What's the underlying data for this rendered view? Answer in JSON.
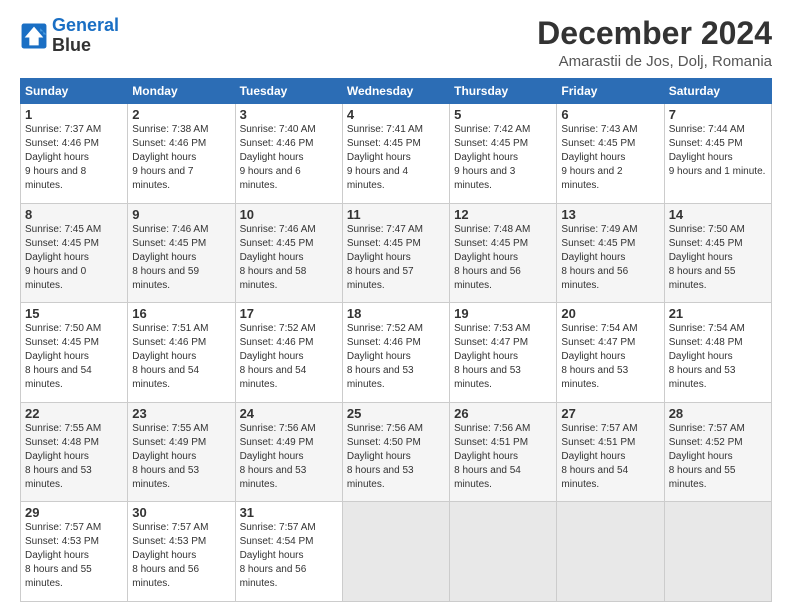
{
  "header": {
    "logo_line1": "General",
    "logo_line2": "Blue",
    "title": "December 2024",
    "subtitle": "Amarastii de Jos, Dolj, Romania"
  },
  "calendar": {
    "days_of_week": [
      "Sunday",
      "Monday",
      "Tuesday",
      "Wednesday",
      "Thursday",
      "Friday",
      "Saturday"
    ],
    "weeks": [
      [
        null,
        {
          "day": "2",
          "sunrise": "7:38 AM",
          "sunset": "4:46 PM",
          "daylight": "9 hours and 7 minutes."
        },
        {
          "day": "3",
          "sunrise": "7:40 AM",
          "sunset": "4:46 PM",
          "daylight": "9 hours and 6 minutes."
        },
        {
          "day": "4",
          "sunrise": "7:41 AM",
          "sunset": "4:45 PM",
          "daylight": "9 hours and 4 minutes."
        },
        {
          "day": "5",
          "sunrise": "7:42 AM",
          "sunset": "4:45 PM",
          "daylight": "9 hours and 3 minutes."
        },
        {
          "day": "6",
          "sunrise": "7:43 AM",
          "sunset": "4:45 PM",
          "daylight": "9 hours and 2 minutes."
        },
        {
          "day": "7",
          "sunrise": "7:44 AM",
          "sunset": "4:45 PM",
          "daylight": "9 hours and 1 minute."
        }
      ],
      [
        {
          "day": "8",
          "sunrise": "7:45 AM",
          "sunset": "4:45 PM",
          "daylight": "9 hours and 0 minutes."
        },
        {
          "day": "9",
          "sunrise": "7:46 AM",
          "sunset": "4:45 PM",
          "daylight": "8 hours and 59 minutes."
        },
        {
          "day": "10",
          "sunrise": "7:46 AM",
          "sunset": "4:45 PM",
          "daylight": "8 hours and 58 minutes."
        },
        {
          "day": "11",
          "sunrise": "7:47 AM",
          "sunset": "4:45 PM",
          "daylight": "8 hours and 57 minutes."
        },
        {
          "day": "12",
          "sunrise": "7:48 AM",
          "sunset": "4:45 PM",
          "daylight": "8 hours and 56 minutes."
        },
        {
          "day": "13",
          "sunrise": "7:49 AM",
          "sunset": "4:45 PM",
          "daylight": "8 hours and 56 minutes."
        },
        {
          "day": "14",
          "sunrise": "7:50 AM",
          "sunset": "4:45 PM",
          "daylight": "8 hours and 55 minutes."
        }
      ],
      [
        {
          "day": "15",
          "sunrise": "7:50 AM",
          "sunset": "4:45 PM",
          "daylight": "8 hours and 54 minutes."
        },
        {
          "day": "16",
          "sunrise": "7:51 AM",
          "sunset": "4:46 PM",
          "daylight": "8 hours and 54 minutes."
        },
        {
          "day": "17",
          "sunrise": "7:52 AM",
          "sunset": "4:46 PM",
          "daylight": "8 hours and 54 minutes."
        },
        {
          "day": "18",
          "sunrise": "7:52 AM",
          "sunset": "4:46 PM",
          "daylight": "8 hours and 53 minutes."
        },
        {
          "day": "19",
          "sunrise": "7:53 AM",
          "sunset": "4:47 PM",
          "daylight": "8 hours and 53 minutes."
        },
        {
          "day": "20",
          "sunrise": "7:54 AM",
          "sunset": "4:47 PM",
          "daylight": "8 hours and 53 minutes."
        },
        {
          "day": "21",
          "sunrise": "7:54 AM",
          "sunset": "4:48 PM",
          "daylight": "8 hours and 53 minutes."
        }
      ],
      [
        {
          "day": "22",
          "sunrise": "7:55 AM",
          "sunset": "4:48 PM",
          "daylight": "8 hours and 53 minutes."
        },
        {
          "day": "23",
          "sunrise": "7:55 AM",
          "sunset": "4:49 PM",
          "daylight": "8 hours and 53 minutes."
        },
        {
          "day": "24",
          "sunrise": "7:56 AM",
          "sunset": "4:49 PM",
          "daylight": "8 hours and 53 minutes."
        },
        {
          "day": "25",
          "sunrise": "7:56 AM",
          "sunset": "4:50 PM",
          "daylight": "8 hours and 53 minutes."
        },
        {
          "day": "26",
          "sunrise": "7:56 AM",
          "sunset": "4:51 PM",
          "daylight": "8 hours and 54 minutes."
        },
        {
          "day": "27",
          "sunrise": "7:57 AM",
          "sunset": "4:51 PM",
          "daylight": "8 hours and 54 minutes."
        },
        {
          "day": "28",
          "sunrise": "7:57 AM",
          "sunset": "4:52 PM",
          "daylight": "8 hours and 55 minutes."
        }
      ],
      [
        {
          "day": "29",
          "sunrise": "7:57 AM",
          "sunset": "4:53 PM",
          "daylight": "8 hours and 55 minutes."
        },
        {
          "day": "30",
          "sunrise": "7:57 AM",
          "sunset": "4:53 PM",
          "daylight": "8 hours and 56 minutes."
        },
        {
          "day": "31",
          "sunrise": "7:57 AM",
          "sunset": "4:54 PM",
          "daylight": "8 hours and 56 minutes."
        },
        null,
        null,
        null,
        null
      ]
    ],
    "week0_day1": {
      "day": "1",
      "sunrise": "7:37 AM",
      "sunset": "4:46 PM",
      "daylight": "9 hours and 8 minutes."
    }
  }
}
